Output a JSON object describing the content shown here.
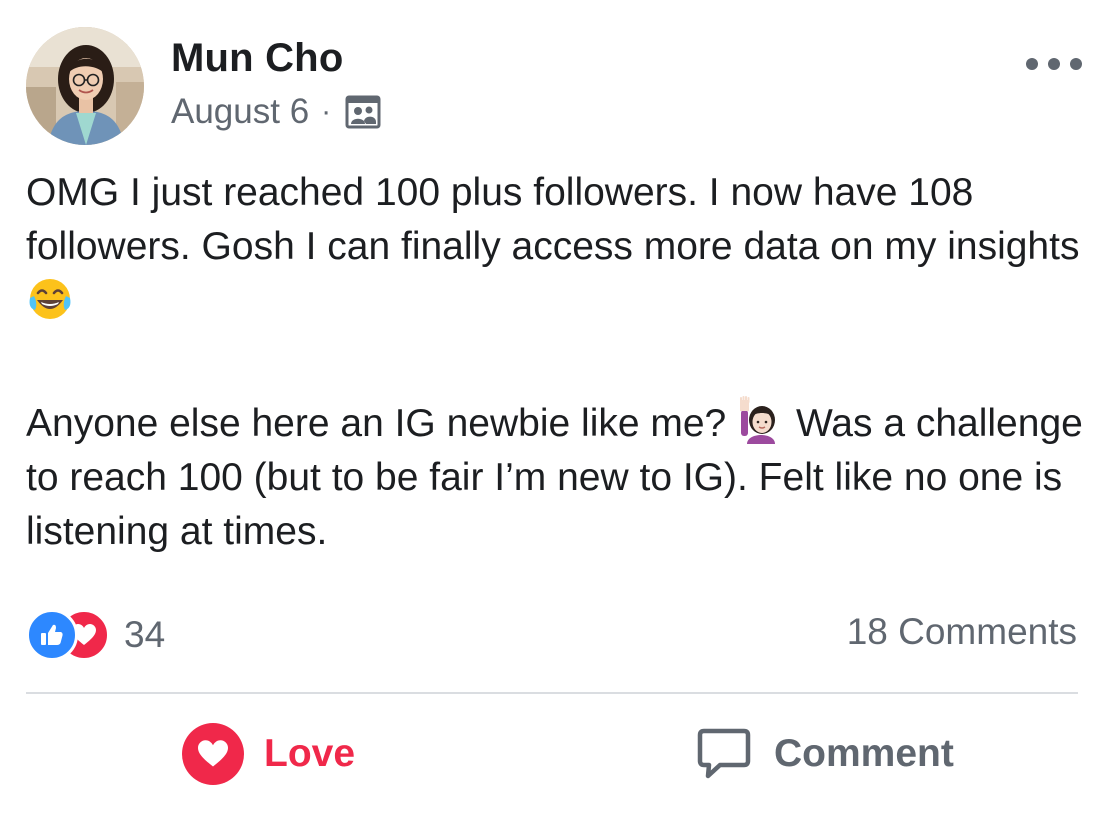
{
  "post": {
    "author": "Mun Cho",
    "date": "August 6",
    "separator": "·",
    "audience_icon": "group-icon",
    "more_icon": "more-options-icon",
    "text": {
      "line1": "OMG I just reached 100 plus followers. I now have 108 followers. Gosh I can finally access more data on my insights",
      "emoji1": "face-with-tears-of-joy",
      "line2_part1": "Anyone else here an IG newbie like me?",
      "emoji2": "person-raising-hand",
      "line2_part2": "Was a challenge to reach 100 (but to be fair I’m new to IG). Felt like no one is listening at times."
    }
  },
  "engagement": {
    "reaction_icons": [
      "like-icon",
      "love-icon"
    ],
    "reaction_count": "34",
    "comments_label": "18 Comments"
  },
  "actions": {
    "love_label": "Love",
    "comment_label": "Comment"
  },
  "colors": {
    "love": "#f0284a",
    "like": "#2d88ff",
    "secondary_text": "#606770",
    "primary_text": "#1c1e21",
    "divider": "#dadde1"
  }
}
